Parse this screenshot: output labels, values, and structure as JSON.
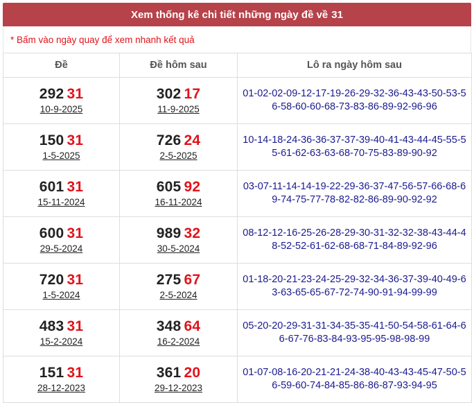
{
  "header": {
    "title": "Xem thống kê chi tiết những ngày đề về",
    "number": "31"
  },
  "note": "* Bấm vào ngày quay để xem nhanh kết quả",
  "columns": [
    "Đề",
    "Đề hôm sau",
    "Lô ra ngày hôm sau"
  ],
  "rows": [
    {
      "de_prefix": "292",
      "de_suffix": "31",
      "de_date": "10-9-2025",
      "next_prefix": "302",
      "next_suffix": "17",
      "next_date": "11-9-2025",
      "lo": "01-02-02-09-12-17-19-26-29-32-36-43-43-50-53-56-58-60-60-68-73-83-86-89-92-96-96"
    },
    {
      "de_prefix": "150",
      "de_suffix": "31",
      "de_date": "1-5-2025",
      "next_prefix": "726",
      "next_suffix": "24",
      "next_date": "2-5-2025",
      "lo": "10-14-18-24-36-36-37-37-39-40-41-43-44-45-55-55-61-62-63-63-68-70-75-83-89-90-92"
    },
    {
      "de_prefix": "601",
      "de_suffix": "31",
      "de_date": "15-11-2024",
      "next_prefix": "605",
      "next_suffix": "92",
      "next_date": "16-11-2024",
      "lo": "03-07-11-14-14-19-22-29-36-37-47-56-57-66-68-69-74-75-77-78-82-82-86-89-90-92-92"
    },
    {
      "de_prefix": "600",
      "de_suffix": "31",
      "de_date": "29-5-2024",
      "next_prefix": "989",
      "next_suffix": "32",
      "next_date": "30-5-2024",
      "lo": "08-12-12-16-25-26-28-29-30-31-32-32-38-43-44-48-52-52-61-62-68-68-71-84-89-92-96"
    },
    {
      "de_prefix": "720",
      "de_suffix": "31",
      "de_date": "1-5-2024",
      "next_prefix": "275",
      "next_suffix": "67",
      "next_date": "2-5-2024",
      "lo": "01-18-20-21-23-24-25-29-32-34-36-37-39-40-49-63-63-65-65-67-72-74-90-91-94-99-99"
    },
    {
      "de_prefix": "483",
      "de_suffix": "31",
      "de_date": "15-2-2024",
      "next_prefix": "348",
      "next_suffix": "64",
      "next_date": "16-2-2024",
      "lo": "05-20-20-29-31-31-34-35-35-41-50-54-58-61-64-66-67-76-83-84-93-95-95-98-98-99"
    },
    {
      "de_prefix": "151",
      "de_suffix": "31",
      "de_date": "28-12-2023",
      "next_prefix": "361",
      "next_suffix": "20",
      "next_date": "29-12-2023",
      "lo": "01-07-08-16-20-21-21-24-38-40-43-43-45-47-50-56-59-60-74-84-85-86-86-87-93-94-95"
    }
  ]
}
